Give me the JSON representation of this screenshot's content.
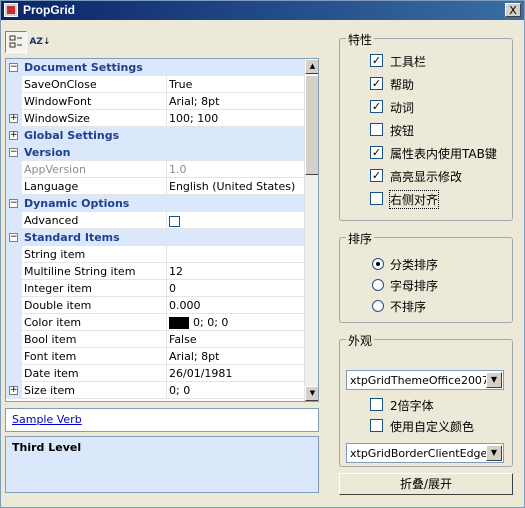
{
  "window": {
    "title": "PropGrid",
    "close_label": "X"
  },
  "toolbar": {
    "categorized_icon": "categorized-icon",
    "alpha_label": "AZ"
  },
  "grid": {
    "rows": [
      {
        "type": "cat",
        "exp": "−",
        "name": "Document Settings"
      },
      {
        "type": "prop",
        "name": "SaveOnClose",
        "value": "True"
      },
      {
        "type": "prop",
        "name": "WindowFont",
        "value": "Arial; 8pt"
      },
      {
        "type": "prop",
        "exp": "+",
        "name": "WindowSize",
        "value": "100; 100"
      },
      {
        "type": "cat",
        "exp": "+",
        "name": "Global Settings"
      },
      {
        "type": "cat",
        "exp": "−",
        "name": "Version"
      },
      {
        "type": "prop",
        "disabled": true,
        "name": "AppVersion",
        "value": "1.0"
      },
      {
        "type": "prop",
        "name": "Language",
        "value": "English (United States)"
      },
      {
        "type": "cat",
        "exp": "−",
        "name": "Dynamic Options"
      },
      {
        "type": "prop",
        "name": "Advanced",
        "value": "",
        "checkbox": true
      },
      {
        "type": "cat",
        "exp": "−",
        "name": "Standard Items"
      },
      {
        "type": "prop",
        "name": "String item",
        "value": ""
      },
      {
        "type": "prop",
        "name": "Multiline String item",
        "value": "12"
      },
      {
        "type": "prop",
        "name": "Integer item",
        "value": "0"
      },
      {
        "type": "prop",
        "name": "Double item",
        "value": "0.000"
      },
      {
        "type": "prop",
        "name": "Color item",
        "value": "0; 0; 0",
        "swatch": "#000000"
      },
      {
        "type": "prop",
        "name": "Bool item",
        "value": "False"
      },
      {
        "type": "prop",
        "name": "Font item",
        "value": "Arial; 8pt"
      },
      {
        "type": "prop",
        "name": "Date item",
        "value": "26/01/1981"
      },
      {
        "type": "prop",
        "exp": "+",
        "name": "Size item",
        "value": "0; 0"
      }
    ]
  },
  "verb": {
    "label": "Sample Verb"
  },
  "help": {
    "title": "Third Level"
  },
  "features": {
    "title": "特性",
    "items": [
      {
        "label": "工具栏",
        "checked": true
      },
      {
        "label": "帮助",
        "checked": true
      },
      {
        "label": "动词",
        "checked": true
      },
      {
        "label": "按钮",
        "checked": false
      },
      {
        "label": "属性表内使用TAB键",
        "checked": true
      },
      {
        "label": "高亮显示修改",
        "checked": true
      },
      {
        "label": "右侧对齐",
        "checked": false
      }
    ]
  },
  "sort": {
    "title": "排序",
    "items": [
      {
        "label": "分类排序",
        "selected": true
      },
      {
        "label": "字母排序",
        "selected": false
      },
      {
        "label": "不排序",
        "selected": false
      }
    ]
  },
  "appearance": {
    "title": "外观",
    "theme_value": "xtpGridThemeOffice2007",
    "double_font_label": "2倍字体",
    "custom_color_label": "使用自定义颜色",
    "border_value": "xtpGridBorderClientEdge"
  },
  "collapse_button": {
    "label": "折叠/展开"
  }
}
